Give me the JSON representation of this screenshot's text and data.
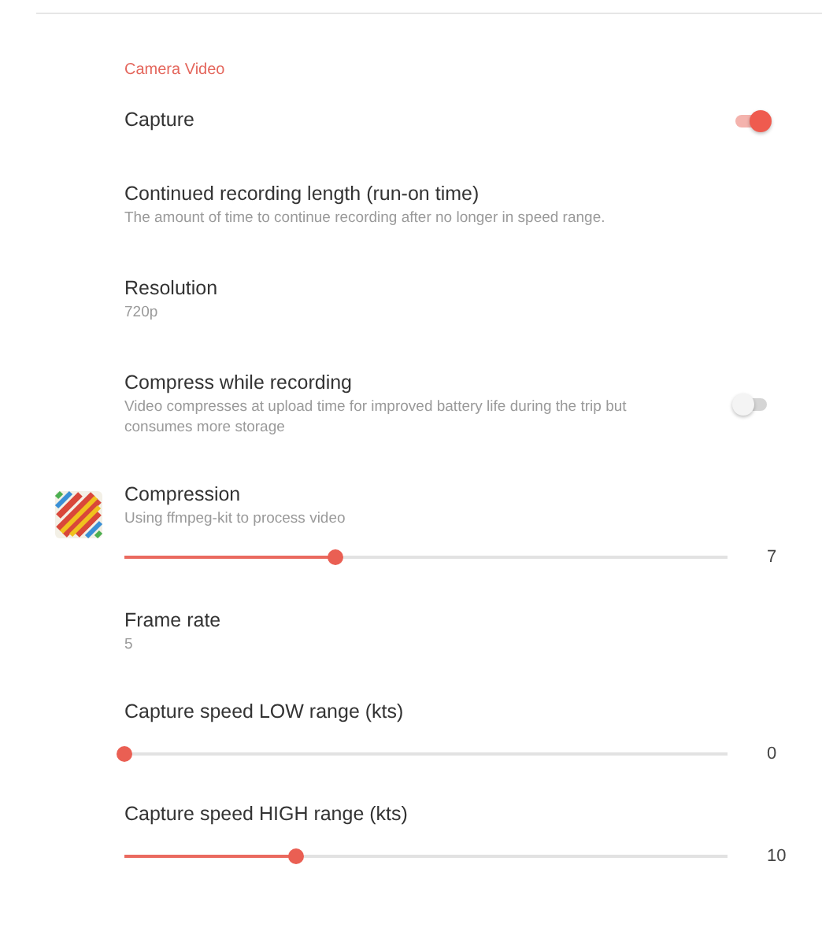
{
  "section": {
    "title": "Camera Video"
  },
  "items": [
    {
      "kind": "switch",
      "title": "Capture",
      "on": true
    },
    {
      "kind": "text",
      "title": "Continued recording length (run-on time)",
      "summary": "The amount of time to continue recording after no longer in speed range."
    },
    {
      "kind": "text",
      "title": "Resolution",
      "summary": "720p"
    },
    {
      "kind": "switch",
      "title": "Compress while recording",
      "summary": "Video compresses at upload time for improved battery life during the trip but consumes more storage",
      "on": false
    },
    {
      "kind": "slider",
      "title": "Compression",
      "summary": "Using ffmpeg-kit to process video",
      "level": 0.35,
      "reading": "7",
      "icon": true
    },
    {
      "kind": "text",
      "title": "Frame rate",
      "summary": "5"
    },
    {
      "kind": "slider",
      "title": "Capture speed LOW range (kts)",
      "level": 0,
      "reading": "0"
    },
    {
      "kind": "slider",
      "title": "Capture speed HIGH range (kts)",
      "level": 0.285,
      "reading": "10"
    }
  ]
}
